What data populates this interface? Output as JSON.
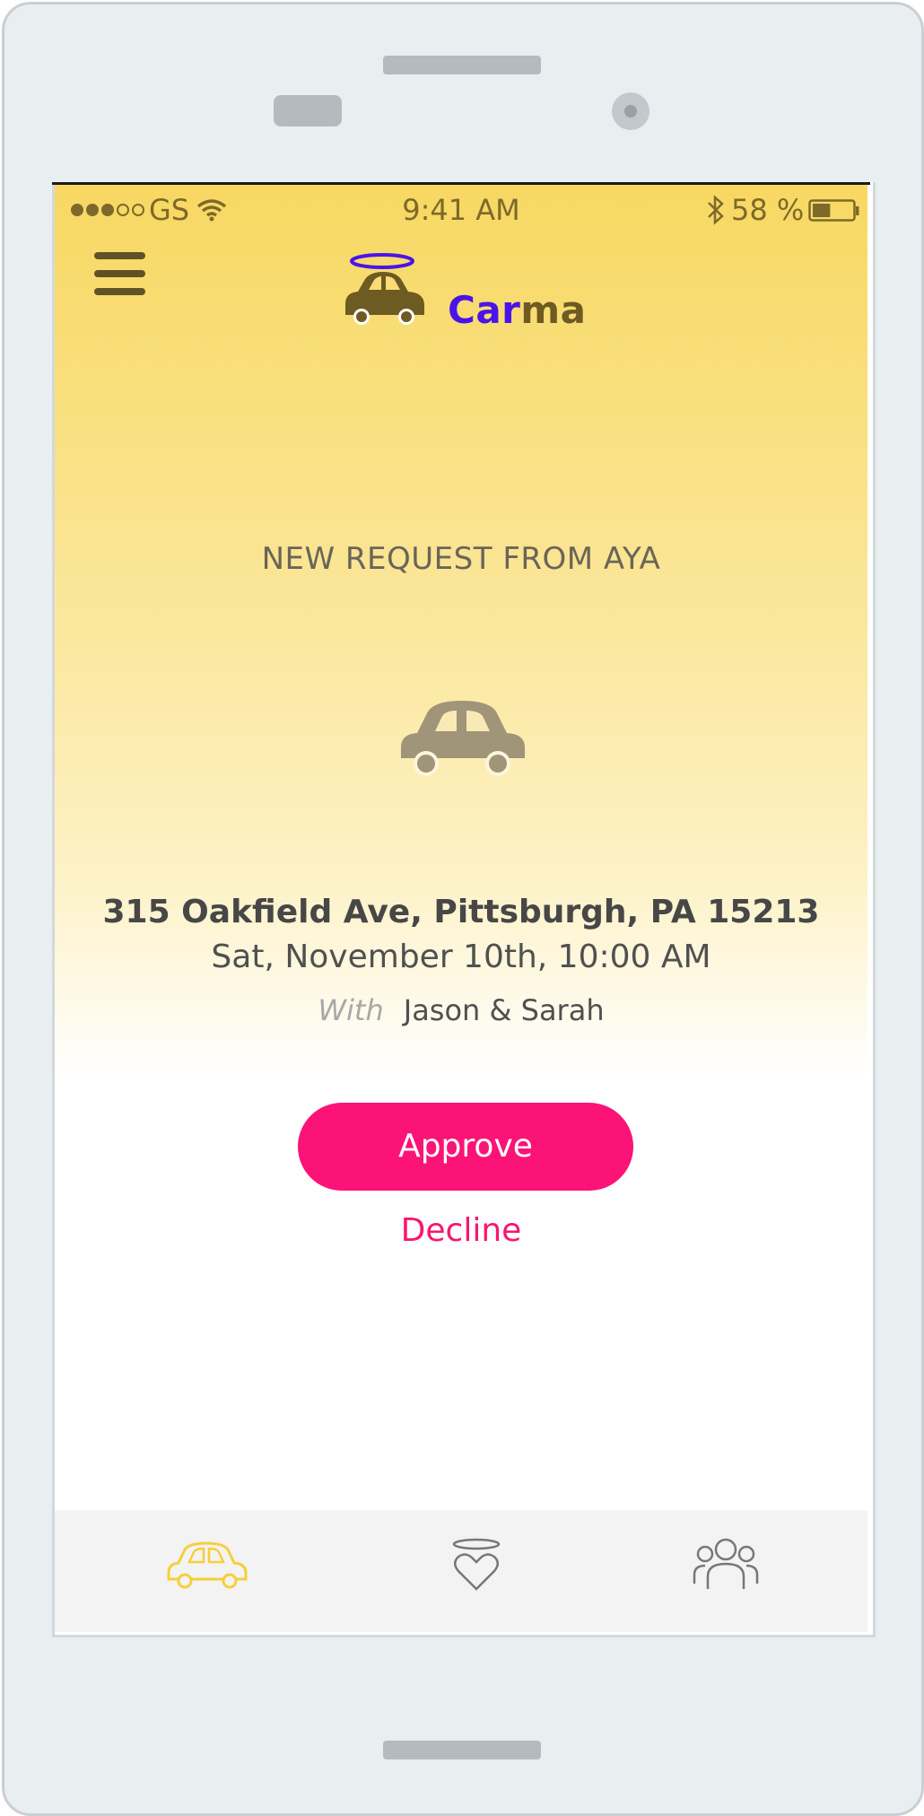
{
  "status_bar": {
    "carrier": "GS",
    "time": "9:41 AM",
    "battery_percent": "58 %",
    "battery_level": 0.45
  },
  "header": {
    "logo_text_part1": "Car",
    "logo_text_part2": "ma"
  },
  "request": {
    "title": "NEW REQUEST FROM AYA",
    "address": "315 Oakfield Ave, Pittsburgh, PA 15213",
    "datetime": "Sat, November 10th, 10:00 AM",
    "with_label": "With",
    "with_names": "Jason & Sarah"
  },
  "actions": {
    "approve_label": "Approve",
    "decline_label": "Decline"
  },
  "colors": {
    "accent_pink": "#fc1377",
    "logo_purple": "#4a14e8",
    "logo_brown": "#6e5b22",
    "active_tab": "#f5d038"
  },
  "tabs": [
    {
      "icon": "car-icon",
      "active": true
    },
    {
      "icon": "halo-heart-icon",
      "active": false
    },
    {
      "icon": "people-icon",
      "active": false
    }
  ]
}
